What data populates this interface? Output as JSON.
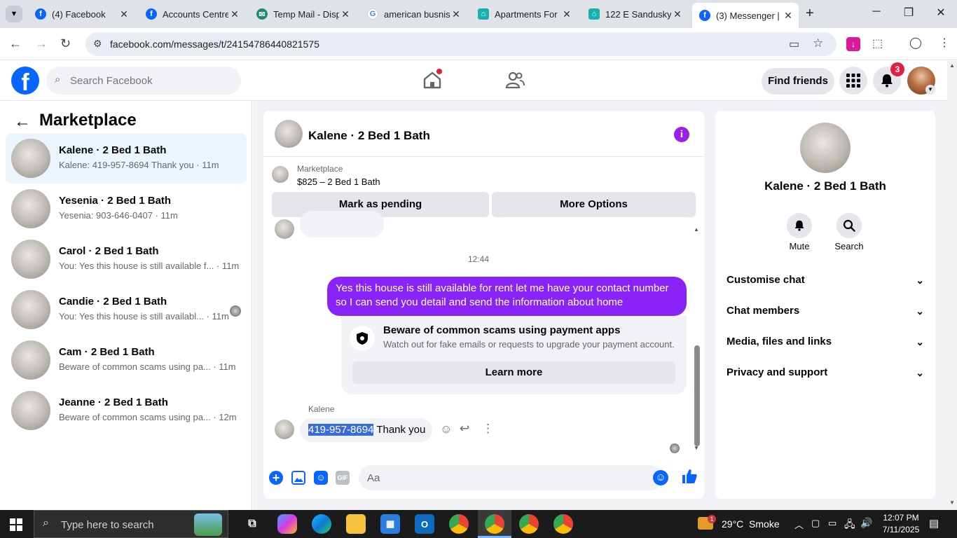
{
  "browser": {
    "tabs": [
      {
        "title": "(4) Facebook",
        "icon": "facebook-icon",
        "color": "#0866ff"
      },
      {
        "title": "Accounts Centre",
        "icon": "facebook-icon",
        "color": "#0866ff"
      },
      {
        "title": "Temp Mail - Disp",
        "icon": "tempmail-icon",
        "color": "#1f8a6e"
      },
      {
        "title": "american busnis",
        "icon": "google-icon",
        "color": "#4285f4"
      },
      {
        "title": "Apartments For",
        "icon": "apartments-icon",
        "color": "#1ab0b0"
      },
      {
        "title": "122 E Sandusky",
        "icon": "apartments-icon",
        "color": "#1ab0b0"
      },
      {
        "title": "(3) Messenger | F",
        "icon": "facebook-icon",
        "color": "#0866ff"
      }
    ],
    "url": "facebook.com/messages/t/24154786440821575"
  },
  "fb_header": {
    "search_placeholder": "Search Facebook",
    "find_friends_label": "Find friends",
    "notification_count": "3"
  },
  "left_panel": {
    "title": "Marketplace",
    "conversations": [
      {
        "name": "Kalene · 2 Bed 1 Bath",
        "preview": "Kalene: 419-957-8694 Thank you · 11m"
      },
      {
        "name": "Yesenia · 2 Bed 1 Bath",
        "preview": "Yesenia: 903-646-0407 · 11m"
      },
      {
        "name": "Carol · 2 Bed 1 Bath",
        "preview": "You: Yes this house is still available f... · 11m"
      },
      {
        "name": "Candie · 2 Bed 1 Bath",
        "preview": "You: Yes this house is still availabl... · 11m"
      },
      {
        "name": "Cam · 2 Bed 1 Bath",
        "preview": "Beware of common scams using pa... · 11m"
      },
      {
        "name": "Jeanne · 2 Bed 1 Bath",
        "preview": "Beware of common scams using pa... · 12m"
      }
    ]
  },
  "chat": {
    "title": "Kalene · 2 Bed 1 Bath",
    "listing_source": "Marketplace",
    "listing_summary": "$825 – 2 Bed 1 Bath",
    "mark_pending_label": "Mark as pending",
    "more_options_label": "More Options",
    "timestamp": "12:44",
    "outgoing_message": "Yes this house is still available for rent let me have your contact number so I can send you detail and send the information about home",
    "scam_title": "Beware of common scams using payment apps",
    "scam_text": "Watch out for fake emails or requests to upgrade your payment account.",
    "learn_more_label": "Learn more",
    "sender_name": "Kalene",
    "incoming_phone": "419-957-8694",
    "incoming_rest": " Thank you",
    "composer_placeholder": "Aa",
    "gif_label": "GIF"
  },
  "right_panel": {
    "name": "Kalene · 2 Bed 1 Bath",
    "mute_label": "Mute",
    "search_label": "Search",
    "sections": [
      "Customise chat",
      "Chat members",
      "Media, files and links",
      "Privacy and support"
    ]
  },
  "taskbar": {
    "search_placeholder": "Type here to search",
    "weather": "29°C  Smoke",
    "weather_badge": "1",
    "time": "12:07 PM",
    "date": "7/11/2025"
  },
  "colors": {
    "fb_blue": "#0866ff",
    "messenger_purple": "#8a23f7",
    "active_conv_bg": "#ebf5ff"
  }
}
